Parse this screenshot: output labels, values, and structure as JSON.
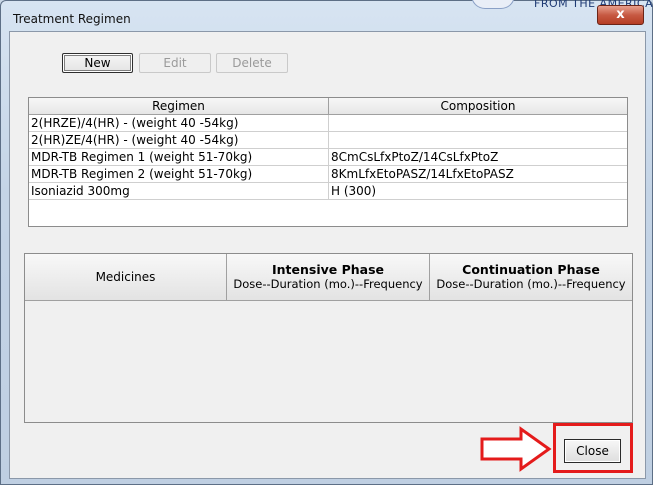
{
  "window": {
    "title": "Treatment Regimen",
    "close_glyph": "x",
    "logo_text": "FROM THE AMERICAN"
  },
  "toolbar": {
    "new_label": "New",
    "edit_label": "Edit",
    "delete_label": "Delete"
  },
  "regimen_table": {
    "headers": [
      "Regimen",
      "Composition"
    ],
    "rows": [
      [
        "2(HRZE)/4(HR) - (weight 40 -54kg)",
        ""
      ],
      [
        "2(HR)ZE/4(HR) - (weight 40 -54kg)",
        ""
      ],
      [
        "MDR-TB Regimen 1 (weight 51-70kg)",
        "8CmCsLfxPtoZ/14CsLfxPtoZ"
      ],
      [
        "MDR-TB Regimen 2 (weight 51-70kg)",
        "8KmLfxEtoPASZ/14LfxEtoPASZ"
      ],
      [
        "Isoniazid 300mg",
        "H (300)"
      ]
    ]
  },
  "medicines_table": {
    "col_medicines": "Medicines",
    "intensive_title": "Intensive Phase",
    "intensive_sub": "Dose--Duration (mo.)--Frequency",
    "continuation_title": "Continuation Phase",
    "continuation_sub": "Dose--Duration (mo.)--Frequency"
  },
  "footer": {
    "close_label": "Close"
  },
  "colors": {
    "annotation_red": "#e41b1b"
  }
}
